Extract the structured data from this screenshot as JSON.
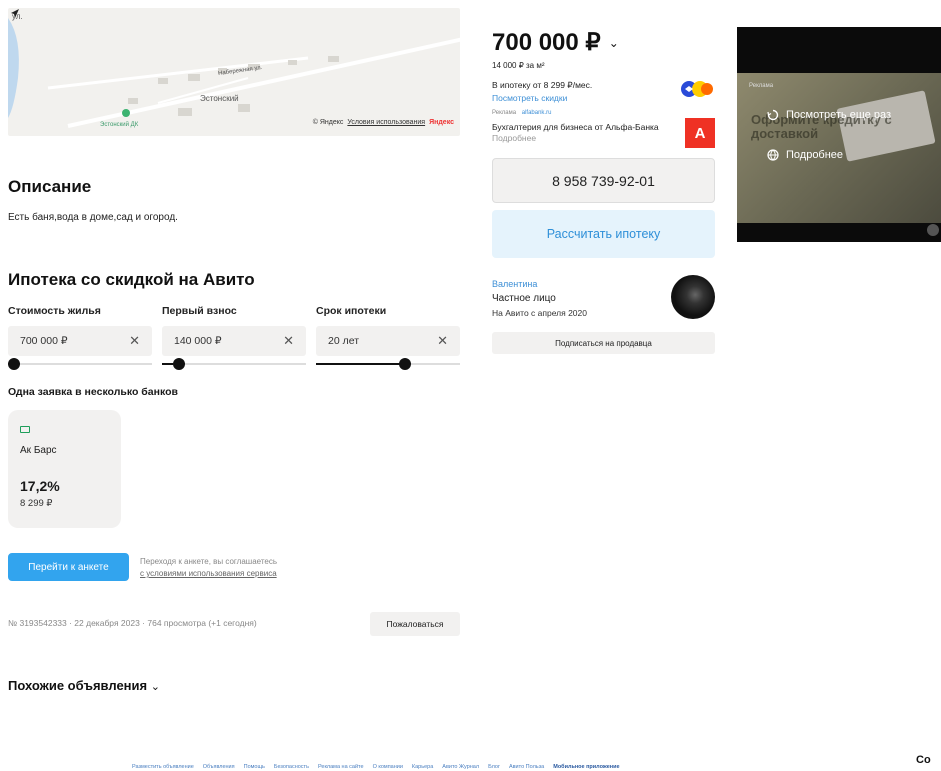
{
  "map": {
    "street_label": "Набережная ул.",
    "village_label": "Эстонский",
    "poi_label": "Эстонский ДК",
    "edge_label": "ул.",
    "copyright": "© Яндекс",
    "terms_link": "Условия использования",
    "brand": "Яндекс"
  },
  "description": {
    "title": "Описание",
    "text": "Есть баня,вода в доме,сад и огород."
  },
  "mortgage": {
    "title": "Ипотека со скидкой на Авито",
    "fields": [
      {
        "label": "Стоимость жилья",
        "value": "700 000 ₽",
        "clear": "✕"
      },
      {
        "label": "Первый взнос",
        "value": "140 000 ₽",
        "clear": "✕"
      },
      {
        "label": "Срок ипотеки",
        "value": "20 лет",
        "clear": "✕"
      }
    ],
    "sliders": [
      0.0,
      0.08,
      0.63
    ],
    "banks_title": "Одна заявка в несколько банков",
    "bank": {
      "name": "Ак Барс",
      "rate": "17,2%",
      "payment": "8 299 ₽"
    },
    "go_button": "Перейти к анкете",
    "agree_text": "Переходя к анкете, вы соглашаетесь",
    "agree_link": "с условиями использования сервиса"
  },
  "listing_meta": {
    "info": "№ 3193542333 · 22 декабря 2023 · 764 просмотра (+1 сегодня)",
    "complain_button": "Пожаловаться"
  },
  "similar": {
    "title": "Похожие объявления",
    "chevron": "⌄"
  },
  "footer": {
    "links": [
      "Разместить объявление",
      "Объявления",
      "Помощь",
      "Безопасность",
      "Реклама на сайте",
      "О компании",
      "Карьера",
      "Авито Журнал",
      "Блог",
      "Авито Пользa"
    ],
    "strong_link": "Мобильное приложение",
    "corner": "Co"
  },
  "sidebar": {
    "price": "700 000 ₽",
    "price_chevron": "⌄",
    "price_per_m2": "14 000 ₽ за м²",
    "mortgage_line": "В ипотеку от 8 299 ₽/мес.",
    "mortgage_link": "Посмотреть скидки",
    "ad_label": "Реклама",
    "ad_domain": "alfabank.ru",
    "ad_title": "Бухгалтерия для бизнеса от Альфа-Банка",
    "ad_more": "Подробнее",
    "alfa_letter": "А",
    "phone": "8 958 739-92-01",
    "calc_button": "Рассчитать ипотеку",
    "seller_name": "Валентина",
    "seller_type": "Частное лицо",
    "seller_since": "На Авито с апреля 2020",
    "subscribe_button": "Подписаться на продавца"
  },
  "video_ad": {
    "tag": "Реклама",
    "bg_text": "Оформите кредитку с доставкой",
    "replay": "Посмотреть еще раз",
    "details": "Подробнее"
  },
  "colors": {
    "accent": "#32a4ee",
    "link": "#3d8fd6",
    "alfa": "#ef3124",
    "field_bg": "#f2f1f0"
  }
}
